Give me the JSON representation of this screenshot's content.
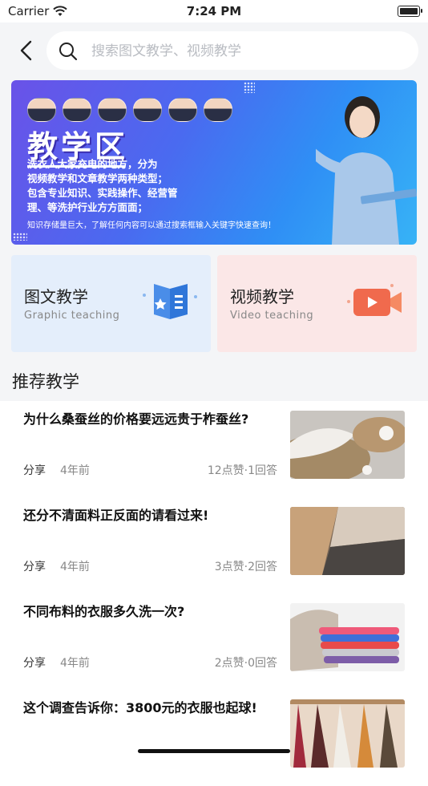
{
  "status_bar": {
    "carrier": "Carrier",
    "time": "7:24 PM",
    "battery_level": 0.85
  },
  "search": {
    "placeholder": "搜索图文教学、视频教学",
    "value": ""
  },
  "banner": {
    "title": "教学区",
    "desc_lines": [
      "洗衣人大家充电的地方，分为",
      "视频教学和文章教学两种类型；",
      "包含专业知识、实践操作、经营管",
      "理、等洗护行业方方面面；"
    ],
    "footer": "知识存储量巨大，了解任何内容可以通过搜索框输入关键字快速查询！"
  },
  "categories": [
    {
      "cn": "图文教学",
      "en": "Graphic teaching",
      "icon": "book-icon"
    },
    {
      "cn": "视频教学",
      "en": "Video teaching",
      "icon": "video-camera-icon"
    }
  ],
  "section_title": "推荐教学",
  "articles": [
    {
      "title": "为什么桑蚕丝的价格要远远贵于柞蚕丝?",
      "tag": "分享",
      "ago": "4年前",
      "stats": "12点赞·1回答",
      "thumb": "silk-thread-photo"
    },
    {
      "title": "还分不清面料正反面的请看过来!",
      "tag": "分享",
      "ago": "4年前",
      "stats": "3点赞·2回答",
      "thumb": "fabric-swatches-photo"
    },
    {
      "title": "不同布料的衣服多久洗一次?",
      "tag": "分享",
      "ago": "4年前",
      "stats": "2点赞·0回答",
      "thumb": "folded-clothes-photo"
    },
    {
      "title": "这个调查告诉你：3800元的衣服也起球!",
      "tag": "",
      "ago": "",
      "stats": "",
      "thumb": "clothes-rack-photo"
    }
  ],
  "colors": {
    "accent_blue": "#3b7ff5",
    "card_blue_bg": "#e4eefb",
    "card_red_bg": "#fbe7e7"
  }
}
